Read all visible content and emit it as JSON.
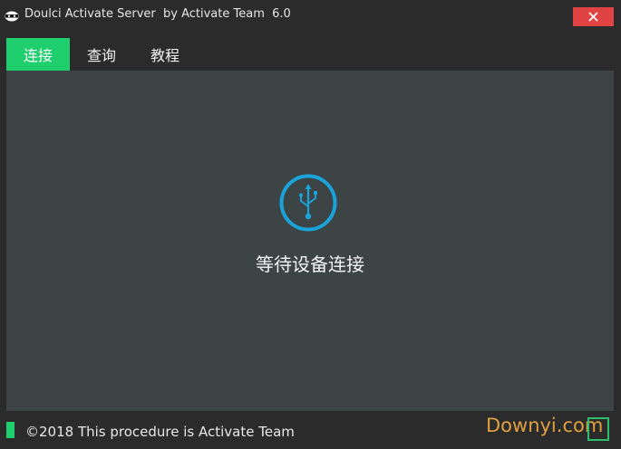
{
  "window": {
    "title": "Doulci Activate Server  by Activate Team  6.0"
  },
  "titlebar": {
    "app_icon": "ninja-mask-icon",
    "close_icon": "close-icon"
  },
  "tabs": [
    {
      "label": "连接",
      "active": true
    },
    {
      "label": "查询",
      "active": false
    },
    {
      "label": "教程",
      "active": false
    }
  ],
  "main": {
    "icon": "usb-icon",
    "status": "等待设备连接"
  },
  "footer": {
    "text": "©2018 This procedure is Activate Team"
  },
  "watermark": {
    "text": "Downyi.com"
  },
  "colors": {
    "accent": "#1fce6d",
    "close": "#e04343",
    "usb": "#1aa3d9",
    "panel": "#3c4446",
    "background": "#2b2b2b"
  }
}
